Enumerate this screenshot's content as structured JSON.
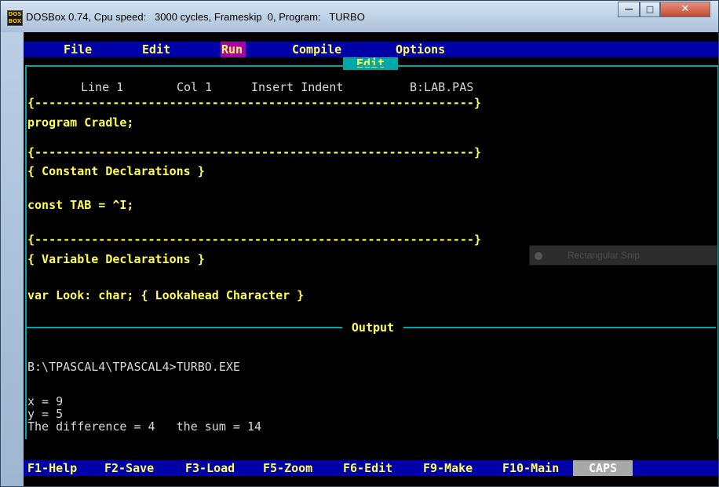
{
  "window": {
    "title": "DOSBox 0.74, Cpu speed:   3000 cycles, Frameskip  0, Program:   TURBO",
    "icon": "DOS BOX",
    "controls": [
      "minimize",
      "maximize",
      "close"
    ]
  },
  "menu": {
    "items": [
      {
        "label": "File"
      },
      {
        "label": "Edit"
      },
      {
        "label": "Run",
        "active": true
      },
      {
        "label": "Compile"
      },
      {
        "label": "Options"
      }
    ]
  },
  "editor": {
    "panel_title": "Edit",
    "status": {
      "line": "Line 1",
      "col": "Col 1",
      "mode": "Insert Indent",
      "file": "B:LAB.PAS"
    },
    "lines": [
      "{--------------------------------------------------------------}",
      "program Cradle;",
      "",
      "{--------------------------------------------------------------}",
      "{ Constant Declarations }",
      "",
      "const TAB = ^I;",
      "",
      "{--------------------------------------------------------------}",
      "{ Variable Declarations }",
      "",
      "var Look: char; { Lookahead Character }"
    ]
  },
  "output": {
    "panel_title": "Output",
    "lines": [
      "B:\\TPASCAL4\\TPASCAL4>TURBO.EXE",
      "",
      "x = 9",
      "y = 5",
      "The difference = 4   the sum = 14"
    ]
  },
  "function_keys": [
    {
      "label": "F1-Help"
    },
    {
      "label": "F2-Save"
    },
    {
      "label": "F3-Load"
    },
    {
      "label": "F5-Zoom"
    },
    {
      "label": "F6-Edit"
    },
    {
      "label": "F9-Make"
    },
    {
      "label": "F10-Main"
    }
  ],
  "caps": "CAPS",
  "overlay": {
    "text": "Rectangular Snip"
  },
  "colors": {
    "menu_bg": "#0000a8",
    "accent": "#00a8a8",
    "highlight": "#ffff55",
    "active": "#a800a8"
  }
}
